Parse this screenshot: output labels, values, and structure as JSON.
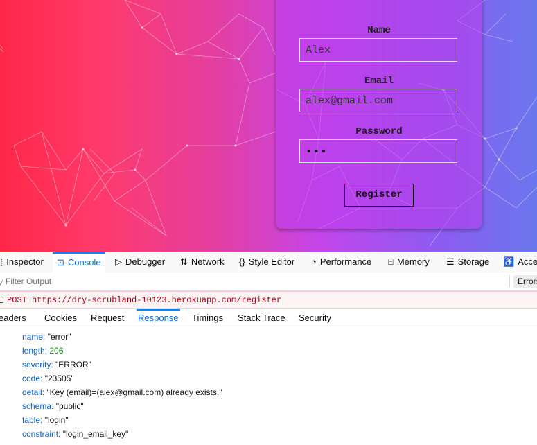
{
  "form": {
    "name_label": "Name",
    "name_value": "Alex",
    "email_label": "Email",
    "email_value": "alex@gmail.com",
    "password_label": "Password",
    "password_value": "•••",
    "register_label": "Register"
  },
  "devtools": {
    "tabs": [
      {
        "icon": "⬚",
        "label": "Inspector"
      },
      {
        "icon": "⊡",
        "label": "Console"
      },
      {
        "icon": "▷",
        "label": "Debugger"
      },
      {
        "icon": "⇅",
        "label": "Network"
      },
      {
        "icon": "{}",
        "label": "Style Editor"
      },
      {
        "icon": "◔",
        "label": "Performance"
      },
      {
        "icon": "⌸",
        "label": "Memory"
      },
      {
        "icon": "☰",
        "label": "Storage"
      },
      {
        "icon": "♿",
        "label": "Acce"
      }
    ],
    "filter_placeholder": "Filter Output",
    "errors_button": "Errors",
    "request": "POST https://dry-scrubland-10123.herokuapp.com/register",
    "subtabs": [
      "Headers",
      "Cookies",
      "Request",
      "Response",
      "Timings",
      "Stack Trace",
      "Security"
    ],
    "subtabs_visible": [
      "eaders",
      "Cookies",
      "Request",
      "Response",
      "Timings",
      "Stack Trace",
      "Security"
    ],
    "selected_subtab": "Response",
    "properties": [
      {
        "key": "name:",
        "value": "\"error\""
      },
      {
        "key": "length:",
        "value": "206"
      },
      {
        "key": "severity:",
        "value": "\"ERROR\""
      },
      {
        "key": "code:",
        "value": "\"23505\""
      },
      {
        "key": "detail:",
        "value": "\"Key (email)=(alex@gmail.com) already exists.\""
      },
      {
        "key": "schema:",
        "value": "\"public\""
      },
      {
        "key": "table:",
        "value": "\"login\""
      },
      {
        "key": "constraint:",
        "value": "\"login_email_key\""
      }
    ]
  },
  "colors": {
    "accent": "#0a84ff",
    "request_error_text": "#a4000f",
    "number_value": "#058b00"
  }
}
